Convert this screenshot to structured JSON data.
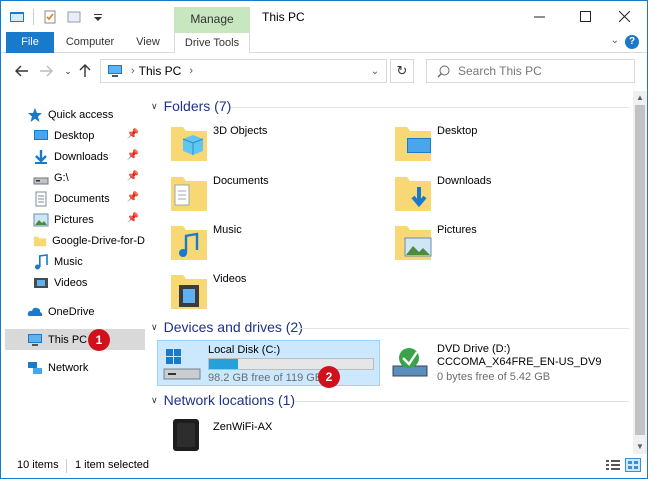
{
  "window": {
    "title": "This PC"
  },
  "ribbon": {
    "contextual_label": "Manage",
    "tabs": [
      {
        "label": "File"
      },
      {
        "label": "Computer"
      },
      {
        "label": "View"
      },
      {
        "label": "Drive Tools"
      }
    ]
  },
  "address": {
    "crumb": "This PC",
    "search_placeholder": "Search This PC"
  },
  "navpane": {
    "quick_access": "Quick access",
    "items": [
      {
        "label": "Desktop",
        "icon": "desktop-icon",
        "pinned": true
      },
      {
        "label": "Downloads",
        "icon": "downloads-icon",
        "pinned": true
      },
      {
        "label": "G:\\",
        "icon": "drive-icon",
        "pinned": true
      },
      {
        "label": "Documents",
        "icon": "documents-icon",
        "pinned": true
      },
      {
        "label": "Pictures",
        "icon": "pictures-icon",
        "pinned": true
      },
      {
        "label": "Google-Drive-for-D",
        "icon": "folder-icon",
        "pinned": false
      },
      {
        "label": "Music",
        "icon": "music-icon",
        "pinned": false
      },
      {
        "label": "Videos",
        "icon": "videos-icon",
        "pinned": false
      }
    ],
    "onedrive": "OneDrive",
    "this_pc": "This PC",
    "network": "Network"
  },
  "badges": {
    "first": "1",
    "second": "2"
  },
  "content": {
    "folders_header": "Folders (7)",
    "folders": [
      {
        "name": "3D Objects"
      },
      {
        "name": "Desktop"
      },
      {
        "name": "Documents"
      },
      {
        "name": "Downloads"
      },
      {
        "name": "Music"
      },
      {
        "name": "Pictures"
      },
      {
        "name": "Videos"
      }
    ],
    "devices_header": "Devices and drives (2)",
    "drives": [
      {
        "name": "Local Disk (C:)",
        "free_text": "98.2 GB free of 119 GB",
        "used_fraction": 0.175
      },
      {
        "name": "DVD Drive (D:)",
        "label": "CCCOMA_X64FRE_EN-US_DV9",
        "free_text": "0 bytes free of 5.42 GB"
      }
    ],
    "network_header": "Network locations (1)",
    "network_items": [
      {
        "name": "ZenWiFi-AX"
      }
    ]
  },
  "status": {
    "items_count": "10 items",
    "selected": "1 item selected"
  },
  "colors": {
    "accent": "#1979ca",
    "manage_tab": "#c8e6c0",
    "badge": "#d0111b",
    "progress": "#26a0da",
    "header_text": "#1e3287"
  }
}
